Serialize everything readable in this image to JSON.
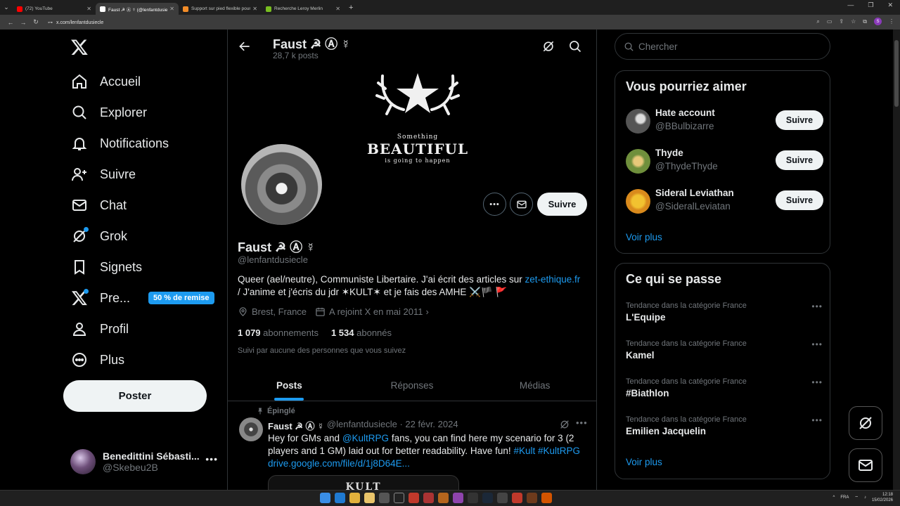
{
  "browser": {
    "tabs": [
      {
        "title": "(72) YouTube",
        "color": "#ff0000"
      },
      {
        "title": "Faust ☭ Ⓐ ☿ (@lenfantdusiecle) / X",
        "color": "#ffffff"
      },
      {
        "title": "Support sur pied flexible pour tab...",
        "color": "#f28c28"
      },
      {
        "title": "Recherche Leroy Merlin",
        "color": "#78be20"
      }
    ],
    "url": "x.com/lenfantdusiecle",
    "profile_initial": "S"
  },
  "nav": {
    "items": [
      {
        "label": "Accueil",
        "icon": "home-icon"
      },
      {
        "label": "Explorer",
        "icon": "search-icon"
      },
      {
        "label": "Notifications",
        "icon": "bell-icon"
      },
      {
        "label": "Suivre",
        "icon": "follow-icon"
      },
      {
        "label": "Chat",
        "icon": "mail-icon"
      },
      {
        "label": "Grok",
        "icon": "grok-icon"
      },
      {
        "label": "Signets",
        "icon": "bookmark-icon"
      },
      {
        "label": "Pre...",
        "icon": "x-premium-icon"
      },
      {
        "label": "Profil",
        "icon": "person-icon"
      },
      {
        "label": "Plus",
        "icon": "more-circle-icon"
      }
    ],
    "premium_badge": "50 % de remise",
    "post_button": "Poster",
    "account": {
      "name": "Benedittini Sébasti...",
      "handle": "@Skebeu2B"
    }
  },
  "header": {
    "name": "Faust ☭ Ⓐ ☿",
    "posts": "28,7 k posts"
  },
  "banner": {
    "line1": "Something",
    "line2": "BEAUTIFUL",
    "line3": "is going to happen"
  },
  "profile": {
    "name": "Faust ☭ Ⓐ ☿",
    "handle": "@lenfantdusiecle",
    "bio_1": "Queer (ael/neutre), Communiste Libertaire. J'ai écrit des articles sur",
    "bio_link": "zet-ethique.fr",
    "bio_2": "/  J'anime et j'écris du jdr ✶KULT✶ et je fais des AMHE ⚔️🏴 🚩",
    "location": "Brest, France",
    "joined": "A rejoint X en mai 2011",
    "following_count": "1 079",
    "following_label": "abonnements",
    "followers_count": "1 534",
    "followers_label": "abonnés",
    "followed_by": "Suivi par aucune des personnes que vous suivez",
    "follow_button": "Suivre"
  },
  "tabs": [
    "Posts",
    "Réponses",
    "Médias"
  ],
  "tweet": {
    "pinned": "Épinglé",
    "name": "Faust ☭ Ⓐ ☿",
    "handle_date": "@lenfantdusiecle · 22 févr. 2024",
    "text_1": "Hey for GMs and",
    "mention": "@KultRPG",
    "text_2": "fans, you can find here my scenario for 3 (2 players and 1 GM) laid out for better readability. Have fun!",
    "hashtags": "#Kult #KultRPG",
    "link": "drive.google.com/file/d/1j8D64E...",
    "media_text": "KULT"
  },
  "right": {
    "search_placeholder": "Chercher",
    "suggest_title": "Vous pourriez aimer",
    "suggestions": [
      {
        "name": "Hate account",
        "handle": "@BBulbizarre",
        "button": "Suivre"
      },
      {
        "name": "Thyde",
        "handle": "@ThydeThyde",
        "button": "Suivre"
      },
      {
        "name": "Sideral Leviathan",
        "handle": "@SideralLeviatan",
        "button": "Suivre"
      }
    ],
    "voir_plus": "Voir plus",
    "trends_title": "Ce qui se passe",
    "trends": [
      {
        "category": "Tendance dans la catégorie France",
        "name": "L'Equipe"
      },
      {
        "category": "Tendance dans la catégorie France",
        "name": "Kamel"
      },
      {
        "category": "Tendance dans la catégorie France",
        "name": "#Biathlon"
      },
      {
        "category": "Tendance dans la catégorie France",
        "name": "Emilien Jacquelin"
      }
    ],
    "trends_voir_plus": "Voir plus"
  },
  "taskbar": {
    "lang": "FRA",
    "time": "12:18",
    "date": "15/02/2026"
  },
  "colors": {
    "accent": "#1d9bf0",
    "bg": "#000000",
    "border": "#2f3336",
    "muted": "#71767b"
  }
}
